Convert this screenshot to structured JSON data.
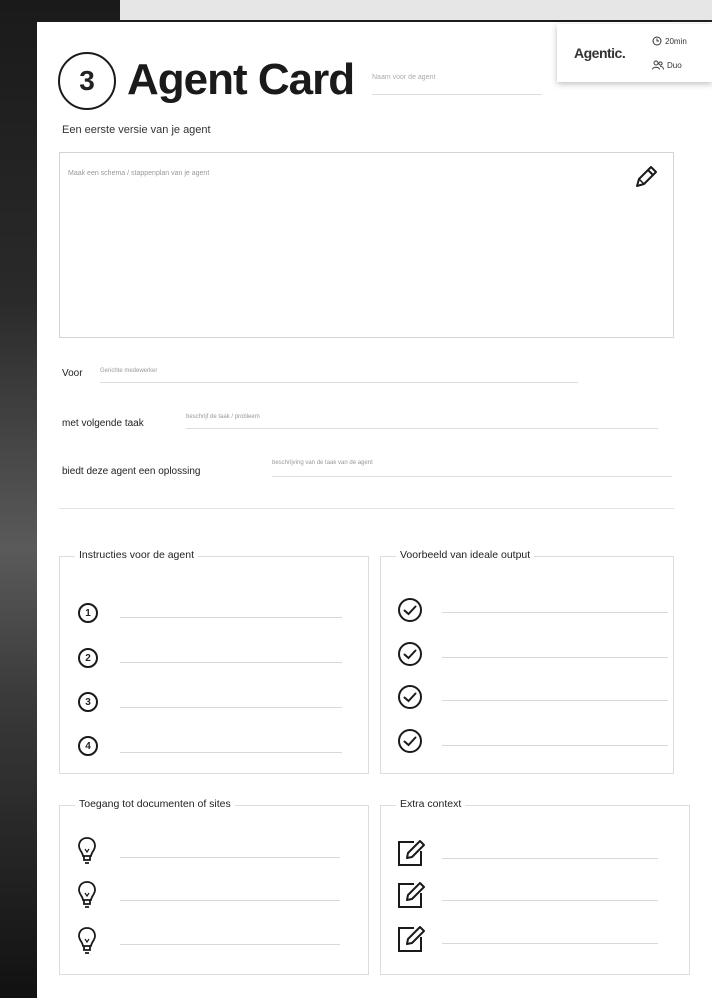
{
  "card": {
    "number": "3",
    "title": "Agent Card",
    "name_placeholder": "Naam voor de agent",
    "subtitle": "Een eerste versie van je agent"
  },
  "logo_card": {
    "brand": "Agentic.",
    "duration": "20min",
    "group": "Duo"
  },
  "sketch": {
    "placeholder": "Maak een schema / stappenplan van je agent"
  },
  "form": {
    "voor_label": "Voor",
    "voor_placeholder": "Gerichte medewerker",
    "taak_label": "met volgende taak",
    "taak_placeholder": "beschrijf de taak / probleem",
    "oplossing_label": "biedt deze agent een oplossing",
    "oplossing_placeholder": "beschrijving van de taak van de agent"
  },
  "panels": {
    "instructions_title": "Instructies voor de agent",
    "instructions_numbers": [
      "1",
      "2",
      "3",
      "4"
    ],
    "output_title": "Voorbeeld van ideale output",
    "access_title": "Toegang tot documenten of sites",
    "context_title": "Extra context"
  },
  "icons": {
    "pencil": "pencil-icon",
    "check": "check-circle-icon",
    "bulb": "lightbulb-icon",
    "edit": "edit-square-icon",
    "clock": "clock-icon",
    "people": "people-icon"
  }
}
